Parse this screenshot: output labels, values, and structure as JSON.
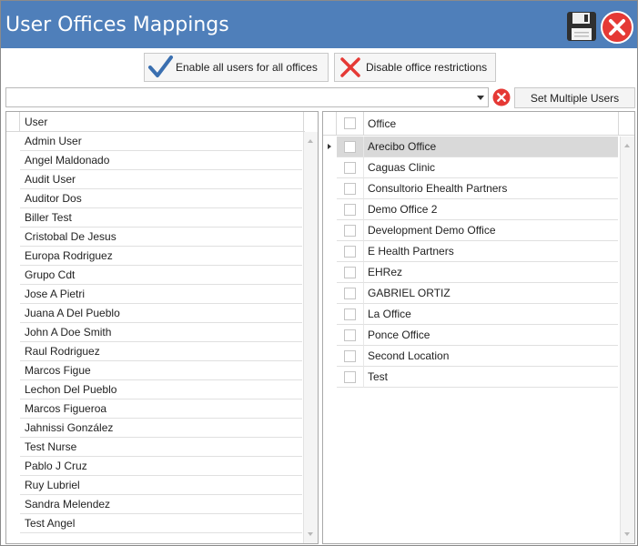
{
  "window": {
    "title": "User Offices Mappings"
  },
  "colors": {
    "titlebar": "#4f7fba",
    "close_red": "#e53935",
    "check_blue": "#3a6fb0",
    "selected_row": "#d9d9d9"
  },
  "icons": {
    "save": "floppy-disk-icon",
    "close": "close-circle-icon",
    "enable": "checkmark-icon",
    "disable": "x-mark-icon",
    "clear": "clear-circle-icon"
  },
  "toolbar": {
    "enable_label": "Enable all users for all offices",
    "disable_label": "Disable office restrictions",
    "multi_label": "Set Multiple Users"
  },
  "combo": {
    "value": ""
  },
  "users": {
    "header": "User",
    "rows": [
      "Admin User",
      "Angel Maldonado",
      "Audit User",
      "Auditor Dos",
      "Biller Test",
      "Cristobal De Jesus",
      "Europa Rodriguez",
      "Grupo Cdt",
      "Jose A Pietri",
      "Juana A Del Pueblo",
      "John A Doe Smith",
      "Raul Rodriguez",
      "Marcos Figue",
      "Lechon Del Pueblo",
      "Marcos Figueroa",
      "Jahnissi González",
      "Test Nurse",
      "Pablo J Cruz",
      "Ruy Lubriel",
      "Sandra Melendez",
      "Test Angel"
    ]
  },
  "offices": {
    "header": "Office",
    "selected_index": 0,
    "rows": [
      "Arecibo Office",
      "Caguas Clinic",
      "Consultorio Ehealth Partners",
      "Demo Office 2",
      "Development Demo Office",
      "E Health Partners",
      "EHRez",
      "GABRIEL ORTIZ",
      "La Office",
      "Ponce Office",
      "Second Location",
      "Test"
    ]
  }
}
